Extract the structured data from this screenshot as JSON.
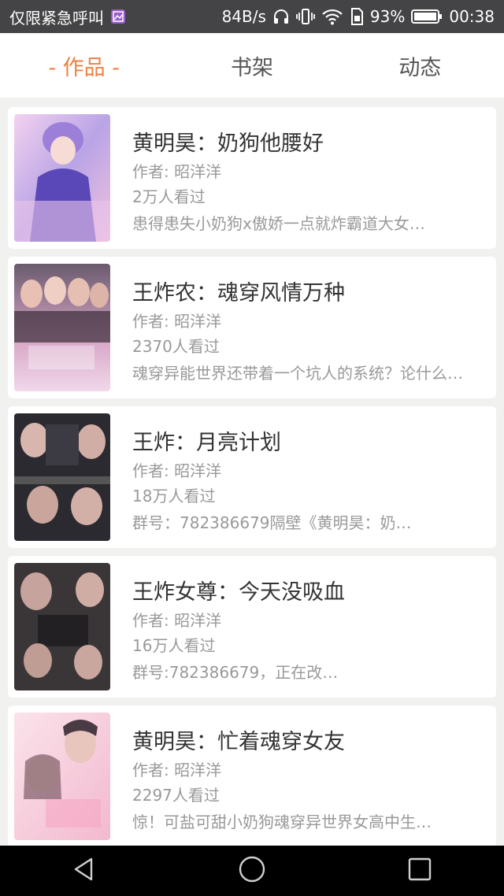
{
  "status_bar": {
    "carrier": "仅限紧急呼叫",
    "speed": "84B/s",
    "battery": "93%",
    "time": "00:38",
    "icons": [
      "gallery-icon",
      "headphones-icon",
      "vibrate-icon",
      "wifi-icon",
      "sim-icon",
      "battery-icon"
    ]
  },
  "tabs": [
    {
      "label": "- 作品 -",
      "active": true
    },
    {
      "label": "书架",
      "active": false
    },
    {
      "label": "动态",
      "active": false
    }
  ],
  "books": [
    {
      "title": "黄明昊：奶狗他腰好",
      "author": "作者: 昭洋洋",
      "views": "2万人看过",
      "desc": "患得患失小奶狗x傲娇一点就炸霸道大女…"
    },
    {
      "title": "王炸农：魂穿风情万种",
      "author": "作者: 昭洋洋",
      "views": "2370人看过",
      "desc": "魂穿异能世界还带着一个坑人的系统？论什么…"
    },
    {
      "title": "王炸：月亮计划",
      "author": "作者: 昭洋洋",
      "views": "18万人看过",
      "desc": "群号：782386679隔壁《黄明昊：奶…"
    },
    {
      "title": "王炸女尊：今天没吸血",
      "author": "作者: 昭洋洋",
      "views": "16万人看过",
      "desc": "群号:782386679，正在改…"
    },
    {
      "title": "黄明昊：忙着魂穿女友",
      "author": "作者: 昭洋洋",
      "views": "2297人看过",
      "desc": "惊！可盐可甜小奶狗魂穿异世界女高中生…"
    }
  ],
  "colors": {
    "accent": "#ee7f42",
    "status_bar": "#444446",
    "background": "#f1f1ef"
  },
  "nav_bar": {
    "icons": [
      "back-icon",
      "home-icon",
      "recents-icon"
    ]
  }
}
